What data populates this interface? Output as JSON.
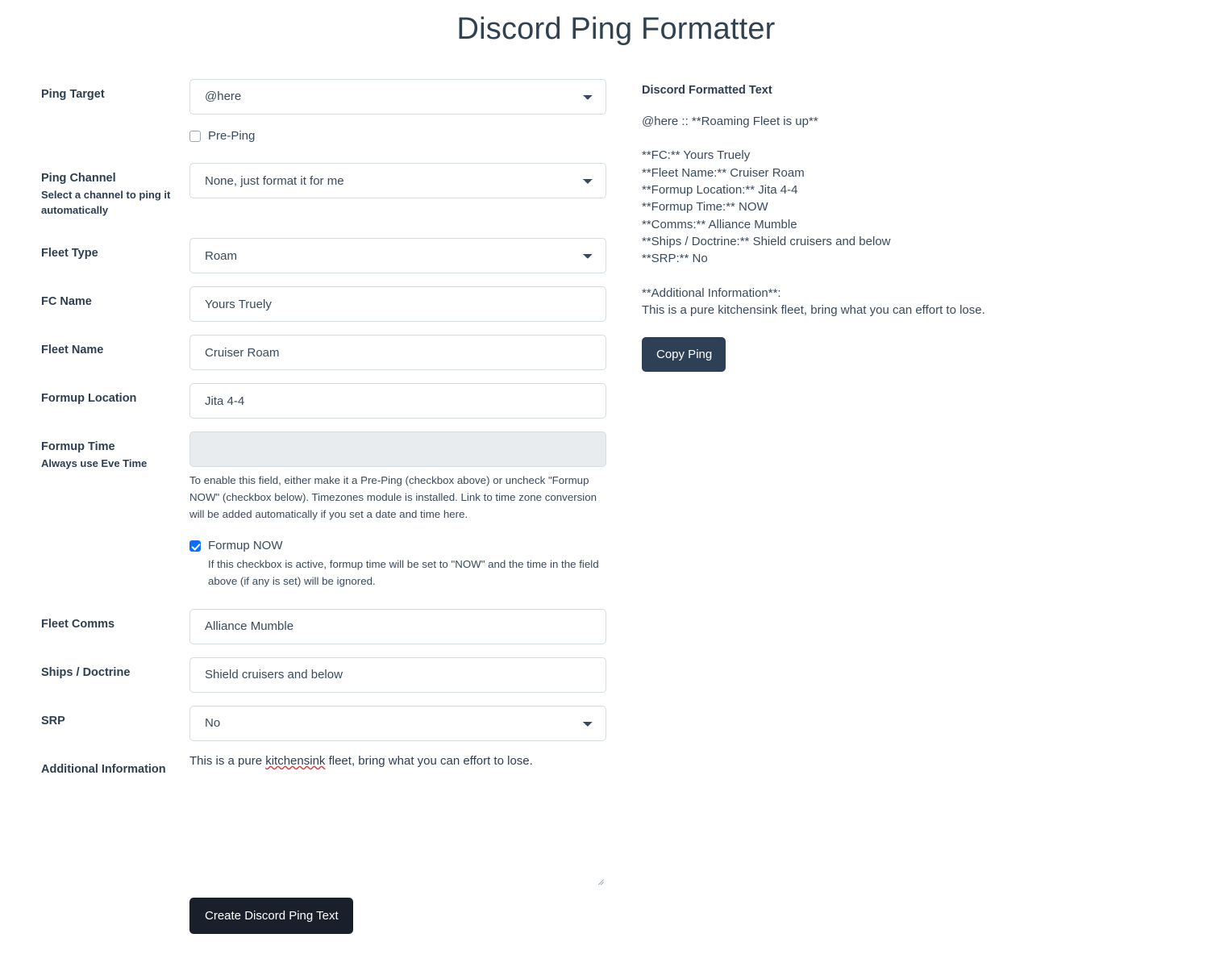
{
  "page": {
    "title": "Discord Ping Formatter"
  },
  "form": {
    "ping_target": {
      "label": "Ping Target",
      "value": "@here"
    },
    "pre_ping": {
      "label": "Pre-Ping",
      "checked": false
    },
    "ping_channel": {
      "label": "Ping Channel",
      "help": "Select a channel to ping it automatically",
      "value": "None, just format it for me"
    },
    "fleet_type": {
      "label": "Fleet Type",
      "value": "Roam"
    },
    "fc_name": {
      "label": "FC Name",
      "value": "Yours Truely"
    },
    "fleet_name": {
      "label": "Fleet Name",
      "value": "Cruiser Roam"
    },
    "formup_location": {
      "label": "Formup Location",
      "value": "Jita 4-4"
    },
    "formup_time": {
      "label": "Formup Time",
      "help": "Always use Eve Time",
      "value": "",
      "disabled": true,
      "description": "To enable this field, either make it a Pre-Ping (checkbox above) or uncheck \"Formup NOW\" (checkbox below). Timezones module is installed. Link to time zone conversion will be added automatically if you set a date and time here."
    },
    "formup_now": {
      "label": "Formup NOW",
      "checked": true,
      "description": "If this checkbox is active, formup time will be set to \"NOW\" and the time in the field above (if any is set) will be ignored."
    },
    "fleet_comms": {
      "label": "Fleet Comms",
      "value": "Alliance Mumble"
    },
    "ships_doctrine": {
      "label": "Ships / Doctrine",
      "value": "Shield cruisers and below"
    },
    "srp": {
      "label": "SRP",
      "value": "No"
    },
    "additional_information": {
      "label": "Additional Information",
      "value_pre": "This is a pure ",
      "value_misspelled": "kitchensink",
      "value_post": " fleet, bring what you can effort to lose."
    },
    "submit_button": "Create Discord Ping Text"
  },
  "output": {
    "title": "Discord Formatted Text",
    "line_header": "@here :: **Roaming Fleet is up**",
    "lines": [
      "**FC:** Yours Truely",
      "**Fleet Name:** Cruiser Roam",
      "**Formup Location:** Jita 4-4",
      "**Formup Time:** NOW",
      "**Comms:** Alliance Mumble",
      "**Ships / Doctrine:** Shield cruisers and below",
      "**SRP:** No"
    ],
    "additional_header": "**Additional Information**:",
    "additional_body": "This is a pure kitchensink fleet, bring what you can effort to lose.",
    "copy_button": "Copy Ping"
  },
  "colors": {
    "title": "#32414f",
    "text": "#3a4a5c",
    "label": "#2e3e50",
    "border": "#d5dde3",
    "disabled_bg": "#e9ecef",
    "checkbox_checked": "#0d6efd",
    "btn_create_bg": "#19202b",
    "btn_copy_bg": "#2e4055",
    "spellcheck_underline": "#d94040"
  }
}
